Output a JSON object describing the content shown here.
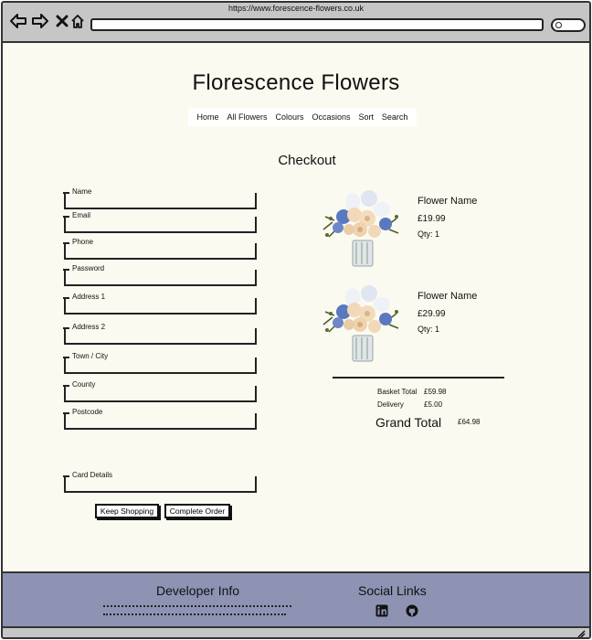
{
  "browser": {
    "url": "https://www.forescence-flowers.co.uk"
  },
  "site": {
    "title": "Florescence Flowers"
  },
  "nav": {
    "items": [
      "Home",
      "All Flowers",
      "Colours",
      "Occasions",
      "Sort",
      "Search"
    ]
  },
  "checkout": {
    "heading": "Checkout",
    "fields": [
      {
        "label": "Name",
        "value": ""
      },
      {
        "label": "Email",
        "value": ""
      },
      {
        "label": "Phone",
        "value": ""
      },
      {
        "label": "Password",
        "value": ""
      },
      {
        "label": "Address 1",
        "value": ""
      },
      {
        "label": "Address 2",
        "value": ""
      },
      {
        "label": "Town / City",
        "value": ""
      },
      {
        "label": "County",
        "value": ""
      },
      {
        "label": "Postcode",
        "value": ""
      },
      {
        "label": "Card Details",
        "value": ""
      }
    ],
    "keep_shopping_label": "Keep Shopping",
    "complete_order_label": "Complete Order"
  },
  "basket": {
    "items": [
      {
        "name": "Flower Name",
        "price": "£19.99",
        "qty": "Qty: 1",
        "image": "flower-bouquet-image"
      },
      {
        "name": "Flower Name",
        "price": "£29.99",
        "qty": "Qty: 1",
        "image": "flower-bouquet-image"
      }
    ],
    "basket_total_label": "Basket Total",
    "basket_total_value": "£59.98",
    "delivery_label": "Delivery",
    "delivery_value": "£5.00",
    "grand_total_label": "Grand Total",
    "grand_total_value": "£64.98"
  },
  "footer": {
    "developer_heading": "Developer Info",
    "social_heading": "Social Links",
    "social_icons": [
      "linkedin-icon",
      "github-icon"
    ],
    "background": "#8e93b3"
  },
  "colors": {
    "page_background": "#fbfaf0",
    "chrome": "#c6c6c6"
  }
}
